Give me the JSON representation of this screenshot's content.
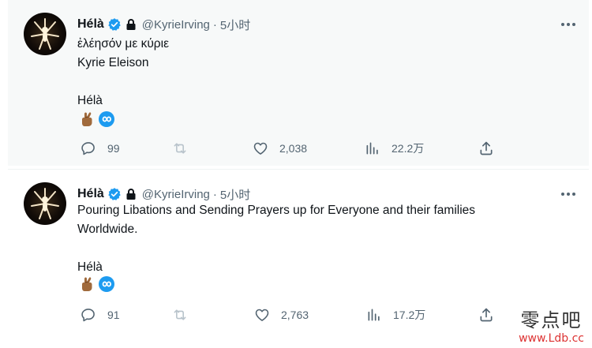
{
  "tweets": [
    {
      "display_name": "Hélà",
      "handle": "@KyrieIrving",
      "separator": "·",
      "time": "5小时",
      "lines": [
        "ἐλέησόν με κύριε",
        "Kyrie Eleison",
        "",
        "Hélà"
      ],
      "reply_count": "99",
      "retweet_count": "",
      "like_count": "2,038",
      "view_count": "22.2万"
    },
    {
      "display_name": "Hélà",
      "handle": "@KyrieIrving",
      "separator": "·",
      "time": "5小时",
      "lines": [
        "Pouring Libations and Sending Prayers up for Everyone and their families",
        "Worldwide.",
        "",
        "Hélà"
      ],
      "reply_count": "91",
      "retweet_count": "",
      "like_count": "2,763",
      "view_count": "17.2万"
    }
  ],
  "icons": {
    "verified": "verified-badge-icon",
    "lock": "lock-icon",
    "more": "more-options-icon",
    "reply": "reply-icon",
    "retweet": "retweet-icon",
    "like": "like-icon",
    "views": "views-icon",
    "share": "share-icon",
    "emoji_1": "crossed-fingers-emoji",
    "emoji_2": "infinity-emoji"
  },
  "colors": {
    "accent": "#1d9bf0",
    "text_secondary": "#536471",
    "highlight_bg": "#f7f9f9"
  },
  "watermark": {
    "top": "零点吧",
    "bottom": "www.Ldb.cc"
  }
}
